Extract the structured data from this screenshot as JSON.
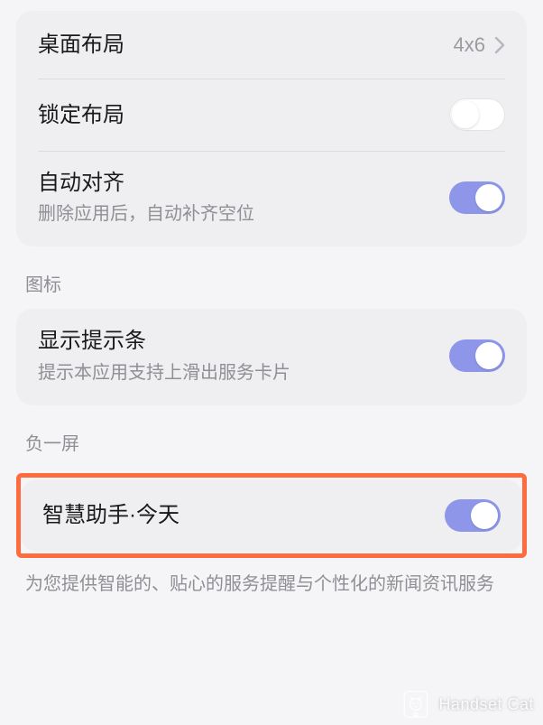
{
  "section1": {
    "desktop_layout": {
      "label": "桌面布局",
      "value": "4x6"
    },
    "lock_layout": {
      "label": "锁定布局",
      "on": false
    },
    "auto_align": {
      "label": "自动对齐",
      "sub": "删除应用后，自动补齐空位",
      "on": true
    }
  },
  "section2": {
    "header": "图标",
    "show_hint_bar": {
      "label": "显示提示条",
      "sub": "提示本应用支持上滑出服务卡片",
      "on": true
    }
  },
  "section3": {
    "header": "负一屏",
    "smart_assistant": {
      "label": "智慧助手·今天",
      "on": true
    },
    "desc": "为您提供智能的、贴心的服务提醒与个性化的新闻资讯服务"
  },
  "watermark": "Handset Cat"
}
